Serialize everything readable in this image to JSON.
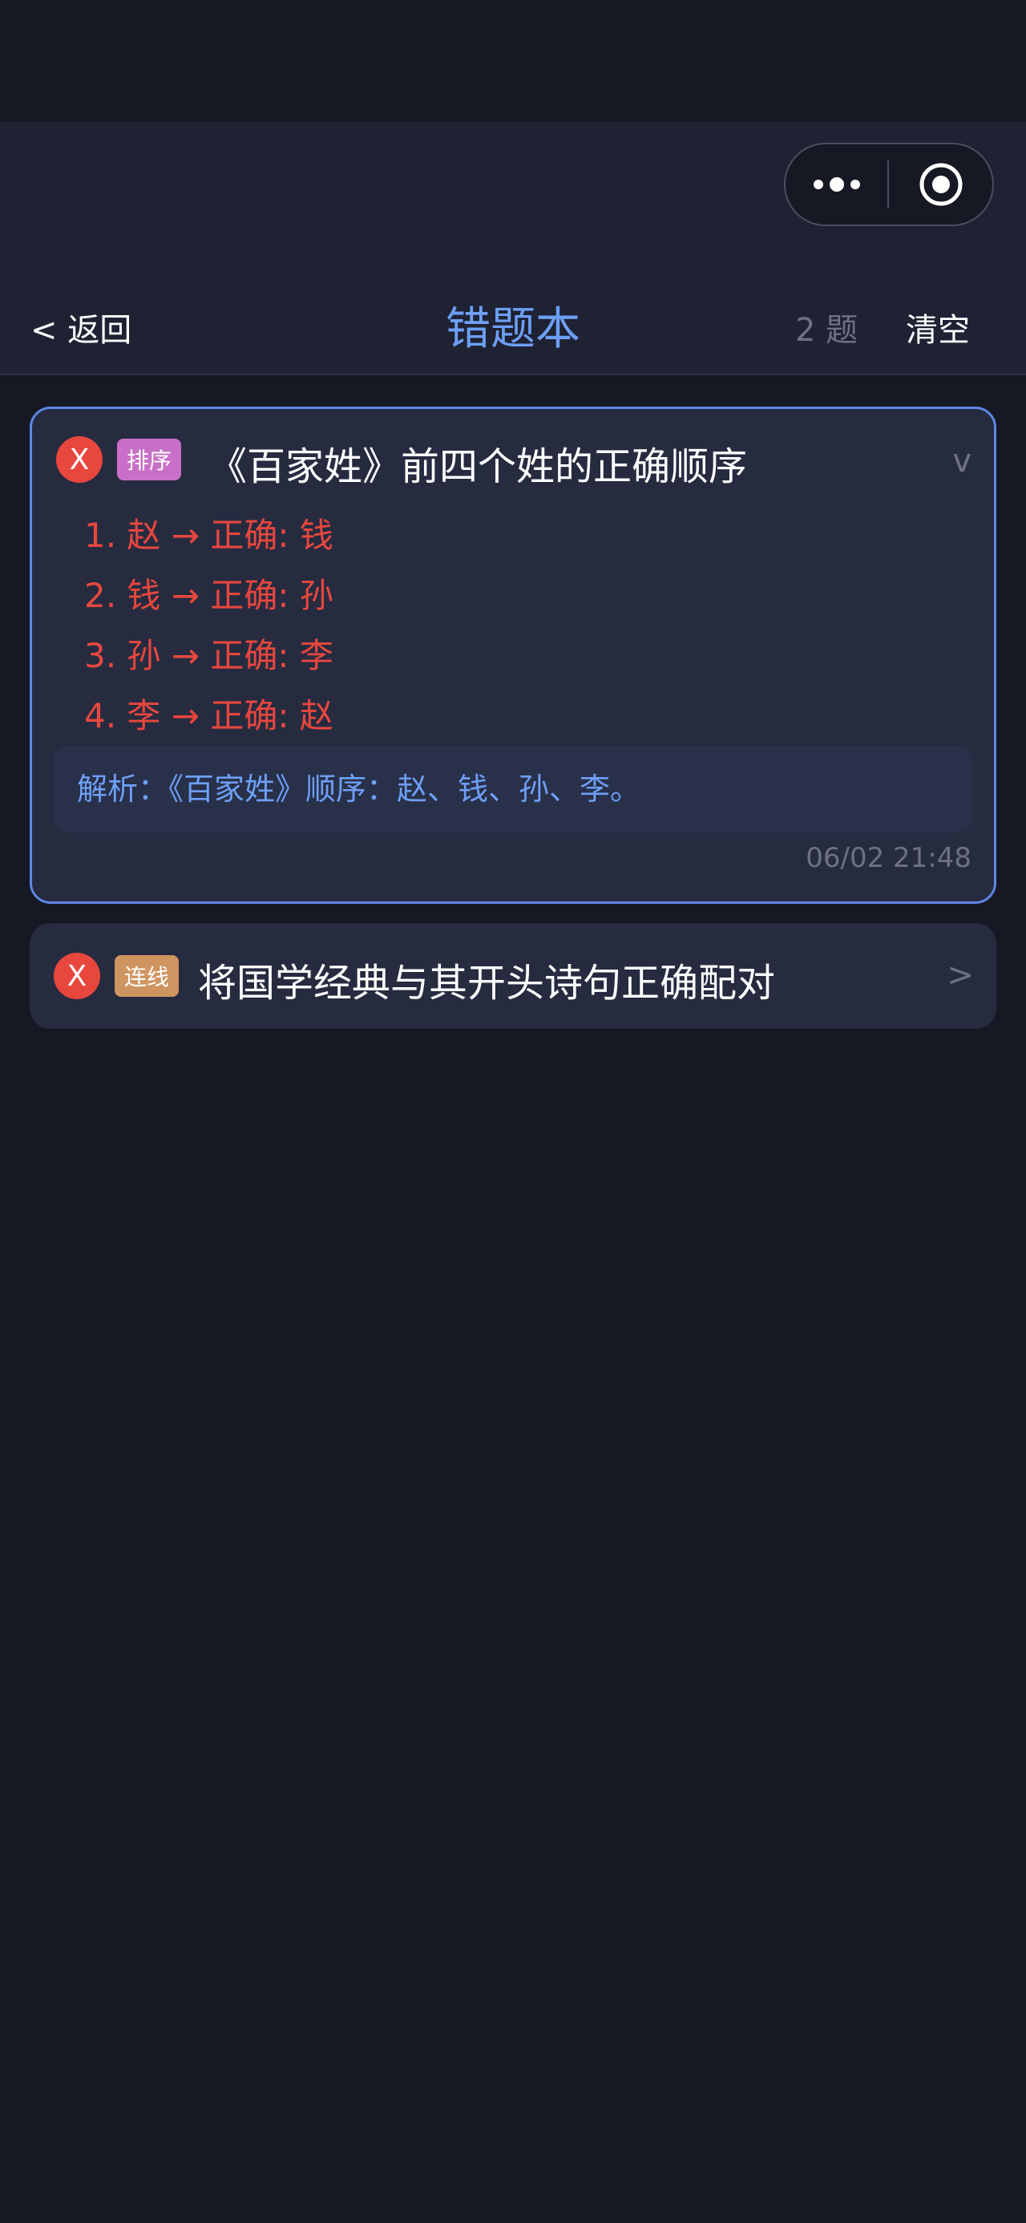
{
  "nav": {
    "more_icon": "more-dots-icon",
    "target_icon": "record-target-icon"
  },
  "header": {
    "back_label": "< 返回",
    "title": "错题本",
    "count": "2 题",
    "clear_label": "清空"
  },
  "items": [
    {
      "wrong_mark": "X",
      "tag": "排序",
      "tag_color": "#c86fc7",
      "title": "《百家姓》前四个姓的正确顺序",
      "chevron": "v",
      "answers": [
        "1. 赵 → 正确: 钱",
        "2. 钱 → 正确: 孙",
        "3. 孙 → 正确: 李",
        "4. 李 → 正确: 赵"
      ],
      "analysis": "解析：《百家姓》顺序：赵、钱、孙、李。",
      "time": "06/02 21:48"
    },
    {
      "wrong_mark": "X",
      "tag": "连线",
      "tag_color": "#cf9560",
      "title": "将国学经典与其开头诗句正确配对",
      "chevron": ">"
    }
  ],
  "colors": {
    "accent": "#6e9ff5",
    "error": "#e8473e",
    "background": "#161824",
    "card": "#272b40"
  }
}
